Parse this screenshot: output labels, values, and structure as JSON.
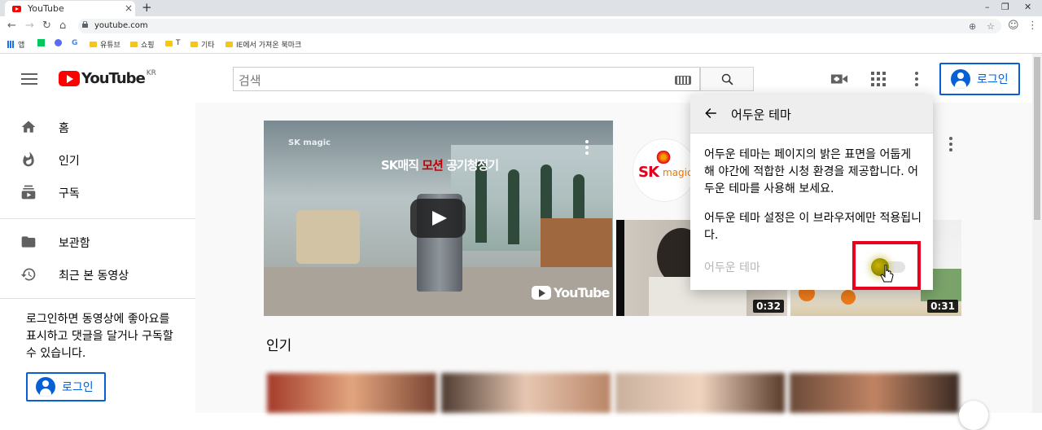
{
  "browser": {
    "tab_title": "YouTube",
    "tab_close": "×",
    "new_tab": "+",
    "url": "youtube.com",
    "window_controls": [
      "–",
      "❐",
      "✕"
    ],
    "bookmarks": [
      "앱",
      "유튜브",
      "쇼핑",
      "T",
      "기타",
      "IE에서 가져온 북마크"
    ]
  },
  "masthead": {
    "logo_text": "YouTube",
    "region": "KR",
    "search_placeholder": "검색",
    "signin_label": "로그인"
  },
  "sidebar": {
    "items": [
      {
        "label": "홈",
        "icon": "home-icon"
      },
      {
        "label": "인기",
        "icon": "fire-icon"
      },
      {
        "label": "구독",
        "icon": "subscriptions-icon"
      },
      {
        "label": "보관함",
        "icon": "folder-icon"
      },
      {
        "label": "최근 본 동영상",
        "icon": "history-icon"
      }
    ],
    "signin_prompt": "로그인하면 동영상에 좋아요를 표시하고 댓글을 달거나 구독할 수 있습니다.",
    "signin_label": "로그인"
  },
  "main": {
    "hero_brand": "SK magic",
    "hero_headline_pre": "SK매직 ",
    "hero_headline_accent": "모션",
    "hero_headline_post": " 공기청정기",
    "hero_watermark": "YouTube",
    "channel_logo_main": "SK",
    "channel_logo_sub": "magic",
    "thumb_durations": [
      "0:32",
      "0:31"
    ],
    "section_title": "인기"
  },
  "dark_theme_popup": {
    "title": "어두운 테마",
    "description": "어두운 테마는 페이지의 밝은 표면을 어둡게 해 야간에 적합한 시청 환경을 제공합니다. 어두운 테마를 사용해 보세요.",
    "note": "어두운 테마 설정은 이 브라우저에만 적용됩니다.",
    "toggle_label": "어두운 테마",
    "toggle_on": false
  },
  "colors": {
    "brand_red": "#ff0000",
    "link_blue": "#065fd4",
    "highlight_box": "#e8001c"
  }
}
